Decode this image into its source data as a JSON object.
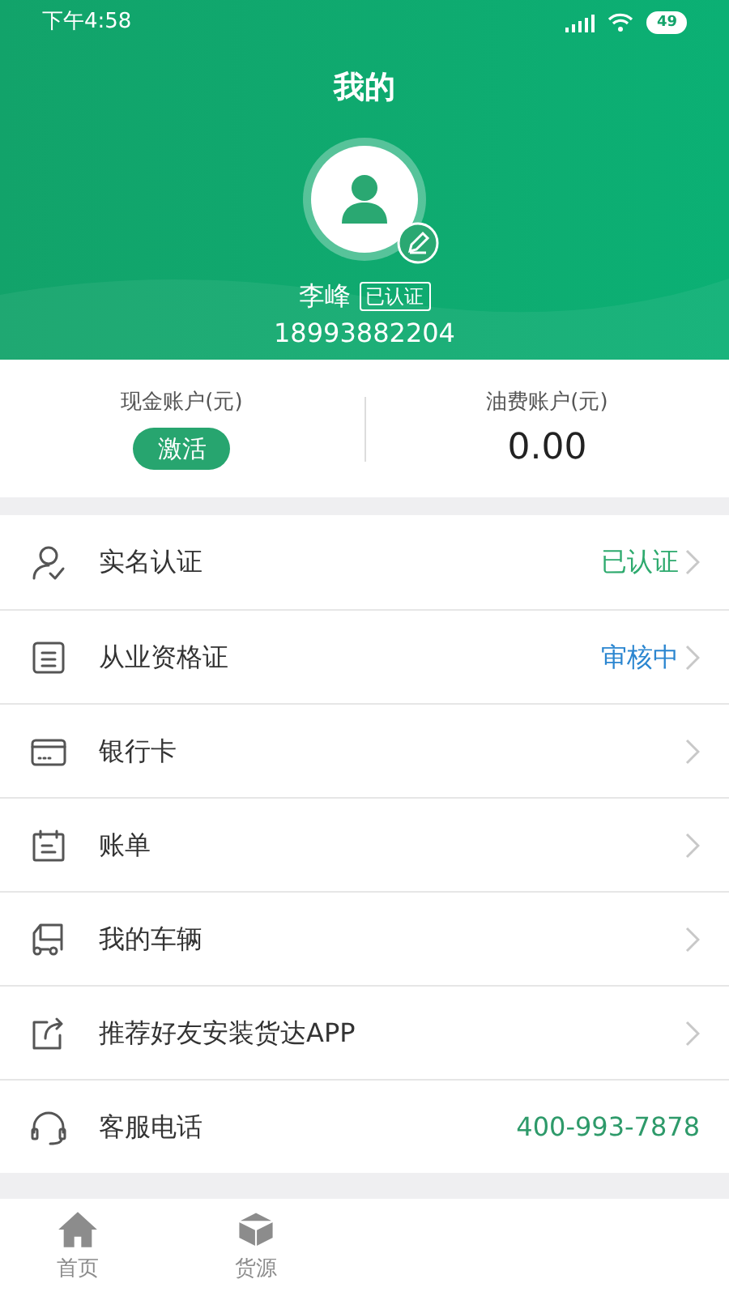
{
  "status_bar": {
    "time": "下午4:58",
    "battery": "49"
  },
  "header": {
    "title": "我的",
    "name": "李峰",
    "verified_badge": "已认证",
    "phone": "18993882204"
  },
  "accounts": [
    {
      "kind": "button",
      "label": "现金账户(元)",
      "action": "激活"
    },
    {
      "kind": "amount",
      "label": "油费账户(元)",
      "value": "0.00"
    }
  ],
  "menu": [
    {
      "kind": "link",
      "label": "实名认证",
      "status": "已认证",
      "color": "#2eaa6e"
    },
    {
      "kind": "link",
      "label": "从业资格证",
      "status": "审核中",
      "color": "#2b86d0"
    },
    {
      "kind": "link",
      "label": "银行卡"
    },
    {
      "kind": "link",
      "label": "账单"
    },
    {
      "kind": "link",
      "label": "我的车辆"
    },
    {
      "kind": "link",
      "label": "推荐好友安装货达APP"
    },
    {
      "kind": "phone",
      "label": "客服电话",
      "value": "400-993-7878",
      "color": "#2e9a6a"
    }
  ],
  "tab_bar": [
    {
      "label": "首页",
      "selected": false
    },
    {
      "label": "货源",
      "selected": false
    }
  ]
}
